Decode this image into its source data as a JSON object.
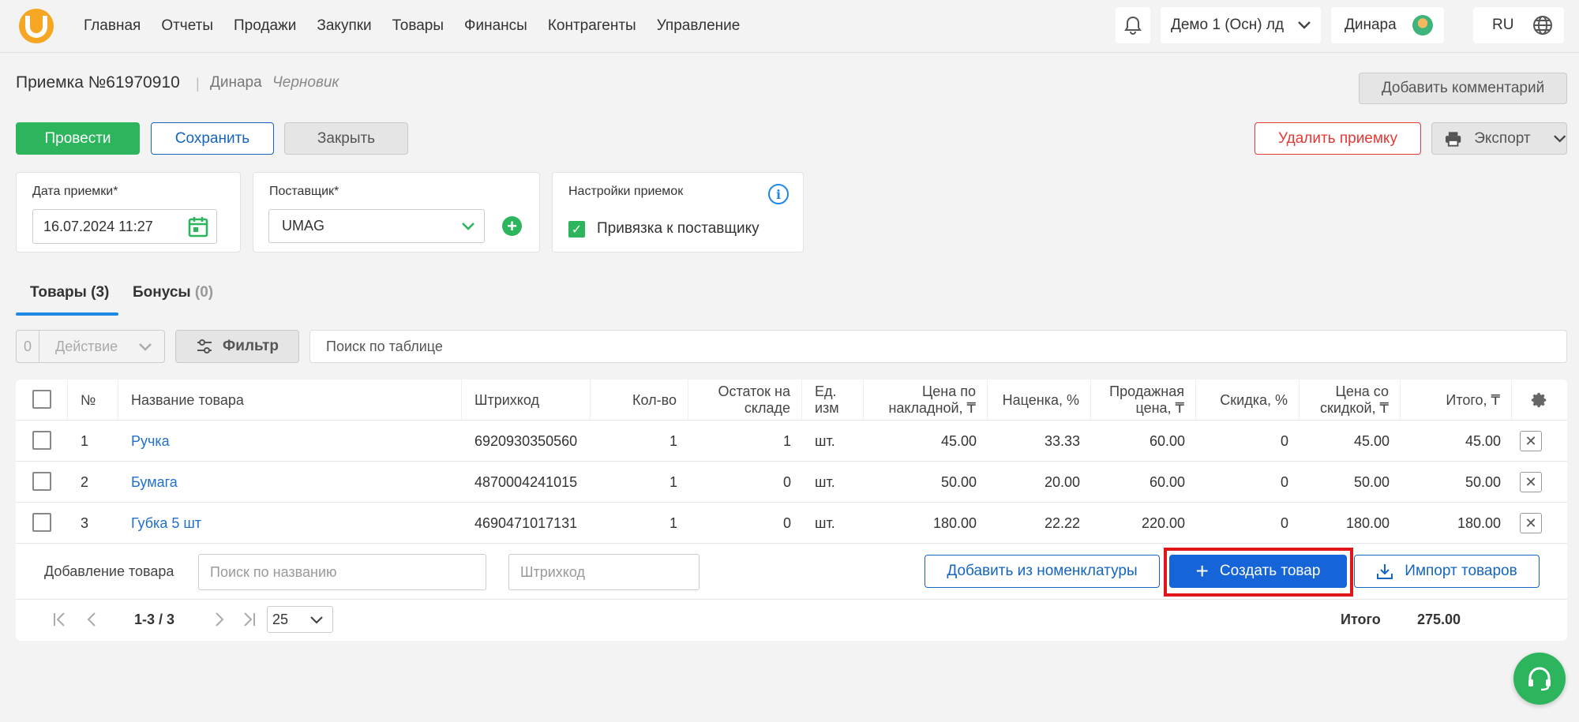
{
  "nav": [
    "Главная",
    "Отчеты",
    "Продажи",
    "Закупки",
    "Товары",
    "Финансы",
    "Контрагенты",
    "Управление"
  ],
  "header": {
    "org": "Демо 1 (Осн) лд",
    "user": "Динара",
    "lang": "RU"
  },
  "doc": {
    "title": "Приемка №61970910",
    "sep": "|",
    "user": "Динара",
    "status": "Черновик"
  },
  "buttons": {
    "comment": "Добавить комментарий",
    "conduct": "Провести",
    "save": "Сохранить",
    "close": "Закрыть",
    "delete": "Удалить приемку",
    "export": "Экспорт"
  },
  "form": {
    "date_label": "Дата приемки*",
    "date_value": "16.07.2024 11:27",
    "supplier_label": "Поставщик*",
    "supplier_value": "UMAG",
    "settings_label": "Настройки приемок",
    "bind_label": "Привязка к поставщику"
  },
  "tabs": {
    "goods": "Товары (3)",
    "bonus": "Бонусы",
    "bonus_count": "(0)"
  },
  "toolbar": {
    "count": "0",
    "action": "Действие",
    "filter": "Фильтр",
    "search_placeholder": "Поиск по таблице"
  },
  "columns": {
    "num": "№",
    "name": "Название товара",
    "barcode": "Штрихкод",
    "qty": "Кол-во",
    "stock": "Остаток на складе",
    "unit": "Ед. изм",
    "price": "Цена по накладной, ₸",
    "markup": "Наценка, %",
    "sale": "Продажная цена, ₸",
    "discount": "Скидка, %",
    "disc_price": "Цена со скидкой, ₸",
    "total": "Итого, ₸"
  },
  "rows": [
    {
      "num": "1",
      "name": "Ручка",
      "barcode": "6920930350560",
      "qty": "1",
      "stock": "1",
      "unit": "шт.",
      "price": "45.00",
      "markup": "33.33",
      "sale": "60.00",
      "discount": "0",
      "disc_price": "45.00",
      "total": "45.00"
    },
    {
      "num": "2",
      "name": "Бумага",
      "barcode": "4870004241015",
      "qty": "1",
      "stock": "0",
      "unit": "шт.",
      "price": "50.00",
      "markup": "20.00",
      "sale": "60.00",
      "discount": "0",
      "disc_price": "50.00",
      "total": "50.00"
    },
    {
      "num": "3",
      "name": "Губка 5 шт",
      "barcode": "4690471017131",
      "qty": "1",
      "stock": "0",
      "unit": "шт.",
      "price": "180.00",
      "markup": "22.22",
      "sale": "220.00",
      "discount": "0",
      "disc_price": "180.00",
      "total": "180.00"
    }
  ],
  "add": {
    "label": "Добавление товара",
    "name_placeholder": "Поиск по названию",
    "barcode_placeholder": "Штрихкод",
    "nomen": "Добавить из номенклатуры",
    "create": "Создать товар",
    "import": "Импорт товаров"
  },
  "pager": {
    "range": "1-3 / 3",
    "size": "25",
    "total_label": "Итого",
    "total_value": "275.00"
  },
  "colors": {
    "primary": "#1565d8",
    "success": "#2db55d",
    "danger": "#e53935",
    "highlight": "#e0161b"
  }
}
